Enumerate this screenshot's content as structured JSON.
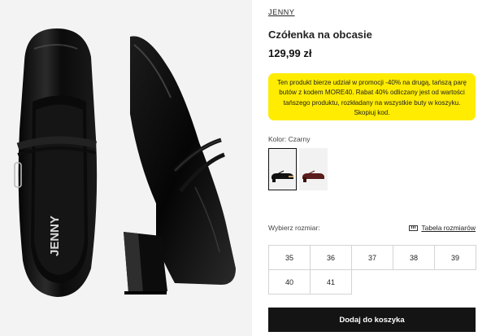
{
  "product": {
    "brand": "JENNY",
    "title": "Czółenka na obcasie",
    "price": "129,99 zł"
  },
  "promo": {
    "text": "Ten produkt bierze udział w promocji -40% na drugą, tańszą parę butów z kodem MORE40. Rabat 40% odliczany jest od wartości tańszego produktu, rozkładany na wszystkie buty w koszyku. Skopiuj kod.",
    "background": "#ffec00"
  },
  "gallery": {
    "image": "black-patent-mary-jane-shoes",
    "insole_print": "JENNY"
  },
  "color": {
    "label": "Kolor: Czarny",
    "swatches": [
      {
        "name": "black-shoe-swatch",
        "selected": true,
        "color": "#111111"
      },
      {
        "name": "burgundy-shoe-swatch",
        "selected": false,
        "color": "#5a1c1c"
      }
    ]
  },
  "size": {
    "label": "Wybierz rozmiar:",
    "guide_label": "Tabela rozmiarów",
    "guide_icon": "ruler-icon",
    "options": [
      "35",
      "36",
      "37",
      "38",
      "39",
      "40",
      "41"
    ]
  },
  "cart": {
    "add_label": "Dodaj do koszyka"
  }
}
